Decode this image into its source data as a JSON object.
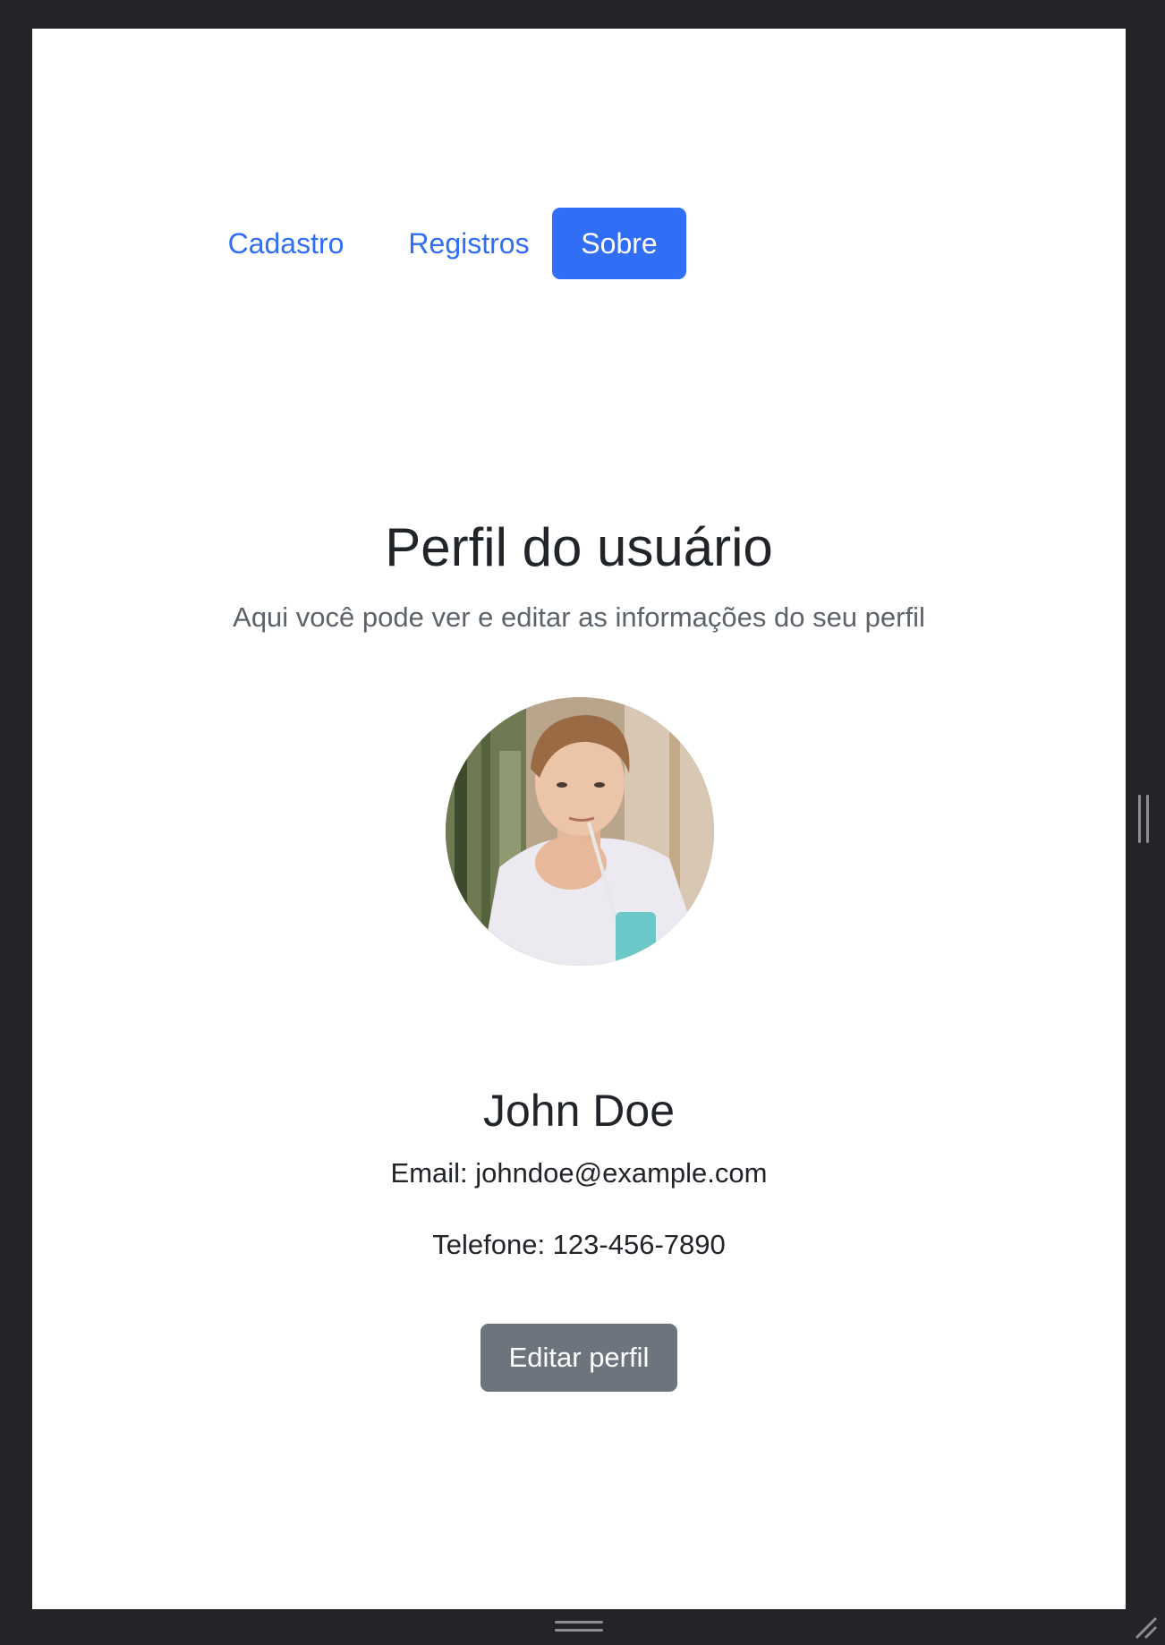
{
  "nav": {
    "items": [
      {
        "label": "Cadastro",
        "active": false
      },
      {
        "label": "Registros",
        "active": false
      },
      {
        "label": "Sobre",
        "active": true
      }
    ],
    "accent_color": "#2f6ef5"
  },
  "profile": {
    "title": "Perfil do usuário",
    "subtitle": "Aqui você pode ver e editar as informações do seu perfil",
    "avatar_icon": "user-photo",
    "name": "John Doe",
    "email_line": "Email: johndoe@example.com",
    "phone_line": "Telefone: 123-456-7890",
    "edit_button_label": "Editar perfil",
    "edit_button_color": "#6c757d"
  }
}
